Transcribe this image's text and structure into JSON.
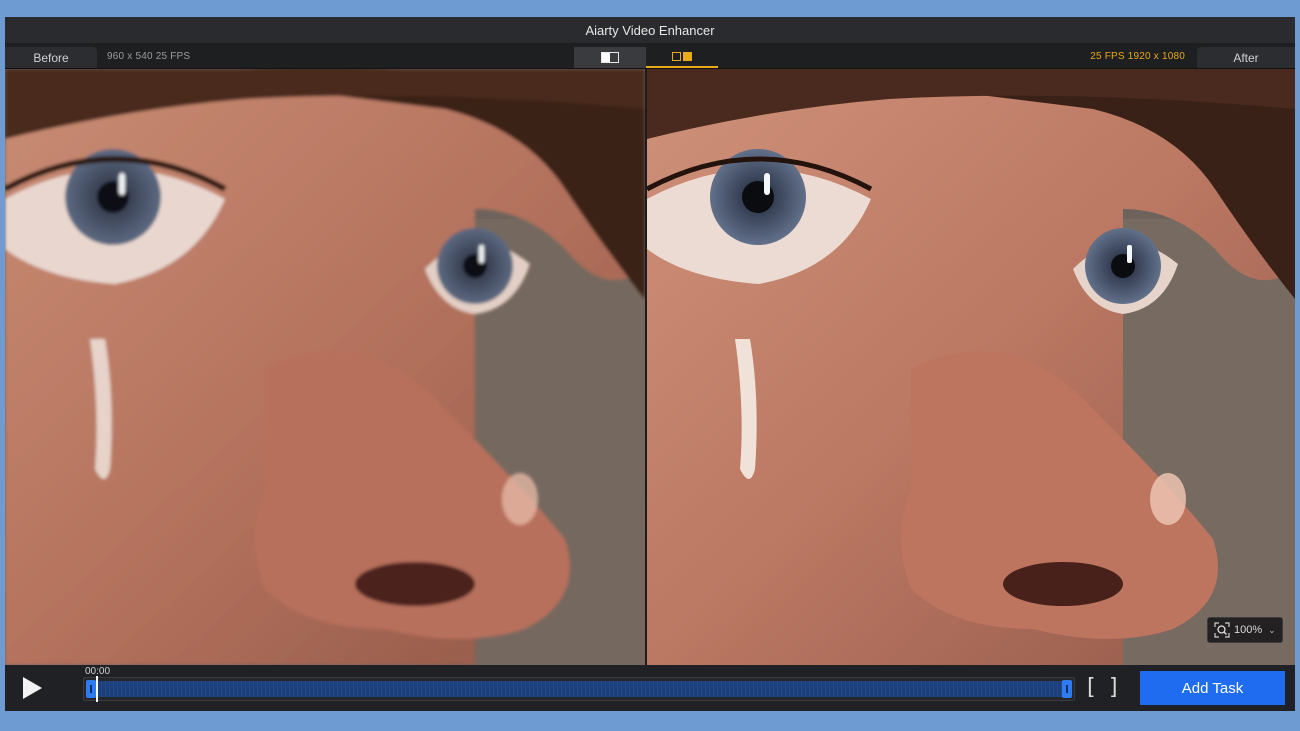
{
  "app": {
    "title": "Aiarty Video Enhancer"
  },
  "toolbar": {
    "before_label": "Before",
    "after_label": "After",
    "source_info": "960 x 540  25 FPS",
    "output_info": "25 FPS  1920 x 1080",
    "view_split_icon": "split-view-icon",
    "view_side_icon": "side-by-side-icon",
    "accent_color": "#e8a91b"
  },
  "preview": {
    "zoom_level": "100%",
    "zoom_icon": "zoom-fit-icon"
  },
  "timeline": {
    "timecode": "00:00",
    "play_icon": "play-icon",
    "in_marker": "[",
    "out_marker": "]",
    "add_task_label": "Add Task",
    "accent_color": "#1f6cf0"
  }
}
